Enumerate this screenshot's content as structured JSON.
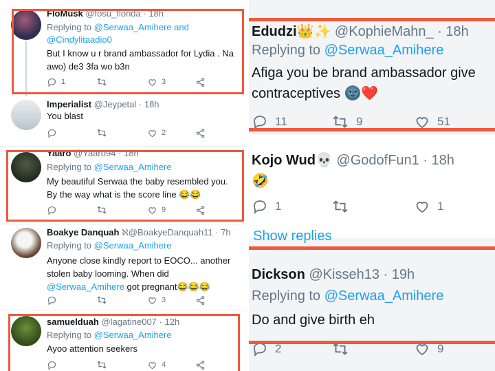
{
  "left": {
    "tweets": [
      {
        "name": "FloMusk",
        "handle": "@fosu_florida",
        "time": "· 18h",
        "reply_prefix": "Replying to ",
        "reply_users": "@Serwaa_Amihere and",
        "reply_users2": "@Cindylitaadio0",
        "line1": "But I know u r brand ambassador for Lydia . Na",
        "line2": "awo) de3 3fa wo b3n",
        "replies": "1",
        "retweets": "",
        "likes": "3"
      },
      {
        "name": "Imperialist",
        "handle": "@Jeypetal",
        "time": "· 18h",
        "line1": "You blast",
        "replies": "",
        "retweets": "",
        "likes": "2"
      },
      {
        "name": "Yaaro",
        "handle": "@Yaaro94",
        "time": "· 18h",
        "reply_prefix": "Replying to ",
        "reply_users": "@Serwaa_Amihere",
        "line1": "My beautiful Serwaa the baby resembled you.",
        "line2": "By the way what is the score line 😂😂",
        "replies": "",
        "retweets": "",
        "likes": "9"
      },
      {
        "name": "Boakye Danquah",
        "badge": "ℵ",
        "handle": "@BoakyeDanquah11",
        "time": "· 7h",
        "reply_prefix": "Replying to ",
        "reply_users": "@Serwaa_Amihere",
        "line1": "Anyone close kindly report to EOCO... another",
        "line2": "stolen baby looming. When did",
        "line3_user": "@Serwaa_Amihere",
        "line3_rest": " got pregnant😂😂😂",
        "replies": "",
        "retweets": "",
        "likes": "3"
      },
      {
        "name": "samuelduah",
        "handle": "@lagatine007",
        "time": "· 12h",
        "reply_prefix": "Replying to ",
        "reply_users": "@Serwaa_Amihere",
        "line1": "Ayoo attention seekers",
        "replies": "",
        "retweets": "",
        "likes": "4"
      }
    ]
  },
  "right": {
    "tweets": [
      {
        "name": "Edudzi👑✨",
        "handle": "@KophieMahn_",
        "time": "· 18h",
        "reply_prefix": "Replying to ",
        "reply_users": "@Serwaa_Amihere",
        "line1": "Afiga you be brand ambassador give",
        "line2": "contraceptives 🌚❤️",
        "replies": "11",
        "retweets": "9",
        "likes": "51"
      },
      {
        "name": "Kojo Wud💀",
        "handle": "@GodofFun1",
        "time": "· 18h",
        "line1": "🤣",
        "replies": "1",
        "retweets": "",
        "likes": "1"
      },
      {
        "name": "Dickson",
        "handle": "@Kisseh13",
        "time": "· 19h",
        "reply_prefix": "Replying to ",
        "reply_users": "@Serwaa_Amihere",
        "line1": "Do and give birth eh",
        "replies": "2",
        "retweets": "",
        "likes": "9"
      }
    ],
    "show_replies": "Show replies"
  },
  "colors": {
    "accent": "#1da1f2",
    "highlight": "#ef5a3c",
    "muted": "#657786"
  },
  "icons": [
    "reply-icon",
    "retweet-icon",
    "like-icon",
    "share-icon"
  ]
}
